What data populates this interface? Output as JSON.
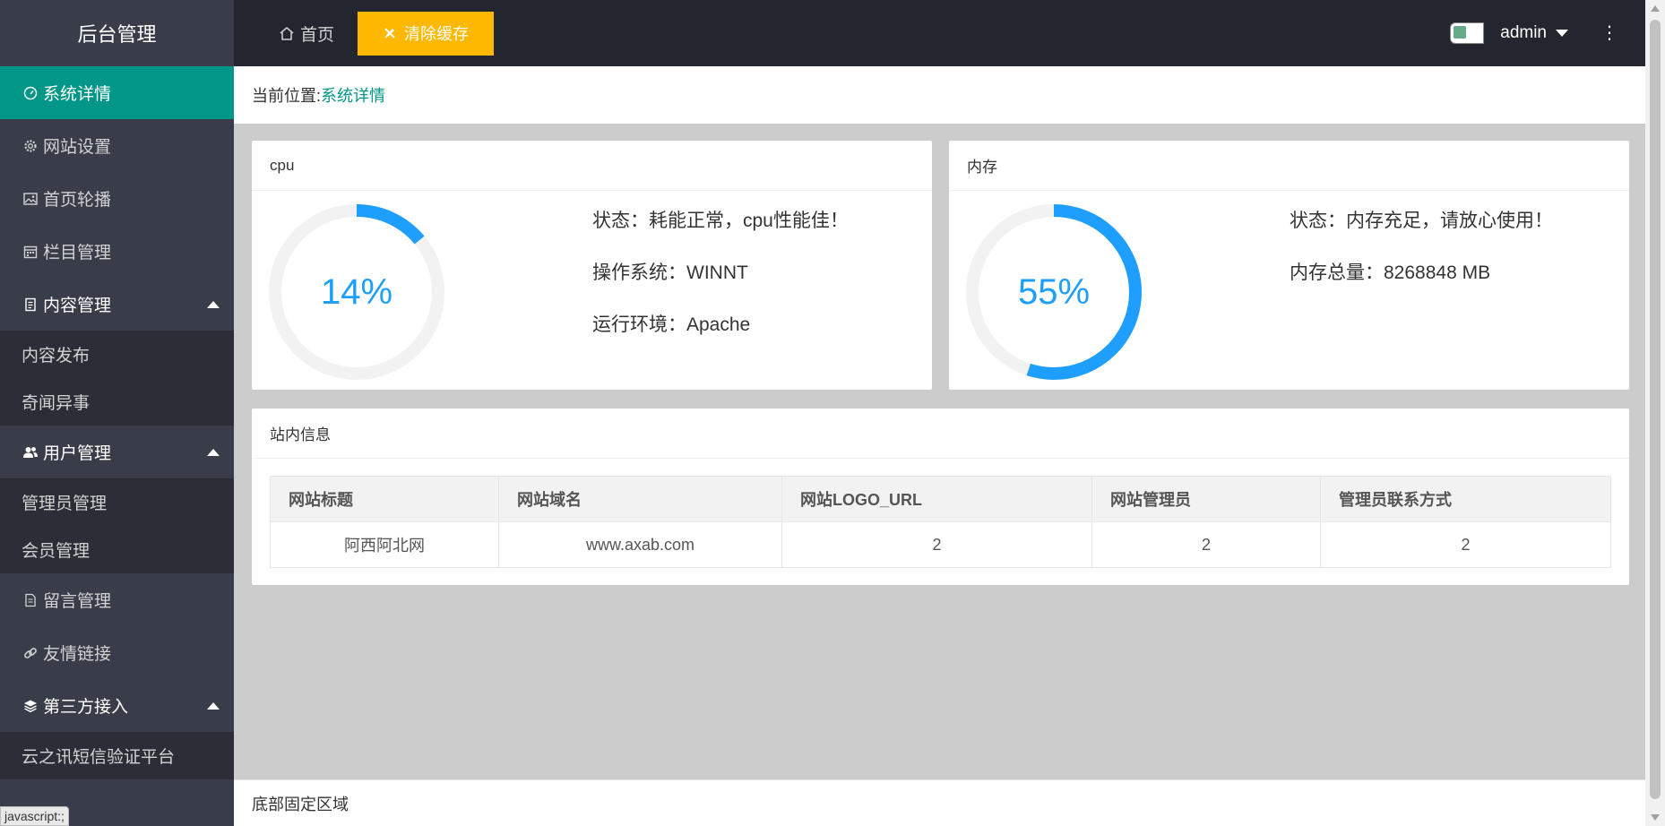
{
  "sidebar": {
    "logo": "后台管理",
    "items": [
      {
        "label": "系统详情",
        "icon": "gauge-icon"
      },
      {
        "label": "网站设置",
        "icon": "gear-icon"
      },
      {
        "label": "首页轮播",
        "icon": "image-icon"
      },
      {
        "label": "栏目管理",
        "icon": "calendar-icon"
      },
      {
        "label": "内容管理",
        "icon": "document-icon",
        "children": [
          "内容发布",
          "奇闻异事"
        ]
      },
      {
        "label": "用户管理",
        "icon": "users-icon",
        "children": [
          "管理员管理",
          "会员管理"
        ]
      },
      {
        "label": "留言管理",
        "icon": "note-icon"
      },
      {
        "label": "友情链接",
        "icon": "link-icon"
      },
      {
        "label": "第三方接入",
        "icon": "layers-icon",
        "children": [
          "云之讯短信验证平台"
        ]
      }
    ],
    "status_tip": "javascript:;"
  },
  "header": {
    "home_label": "首页",
    "clear_cache_label": "清除缓存",
    "user_name": "admin",
    "more_label": "⋮"
  },
  "breadcrumb": {
    "prefix": "当前位置:",
    "current": "系统详情"
  },
  "cpu": {
    "title": "cpu",
    "percent": 14,
    "percent_text": "14%",
    "status": "状态：耗能正常，cpu性能佳！",
    "os": "操作系统：WINNT",
    "env": "运行环境：Apache"
  },
  "memory": {
    "title": "内存",
    "percent": 55,
    "percent_text": "55%",
    "status": "状态：内存充足，请放心使用！",
    "total": "内存总量：8268848 MB"
  },
  "site_info": {
    "title": "站内信息",
    "columns": [
      "网站标题",
      "网站域名",
      "网站LOGO_URL",
      "网站管理员",
      "管理员联系方式"
    ],
    "rows": [
      [
        "阿西阿北网",
        "www.axab.com",
        "2",
        "2",
        "2"
      ]
    ]
  },
  "footer": {
    "text": "底部固定区域"
  },
  "colors": {
    "sidebar_bg": "#393D49",
    "header_bg": "#23262E",
    "active": "#009688",
    "warn_button": "#FFB800",
    "progress": "#1E9FFF"
  }
}
